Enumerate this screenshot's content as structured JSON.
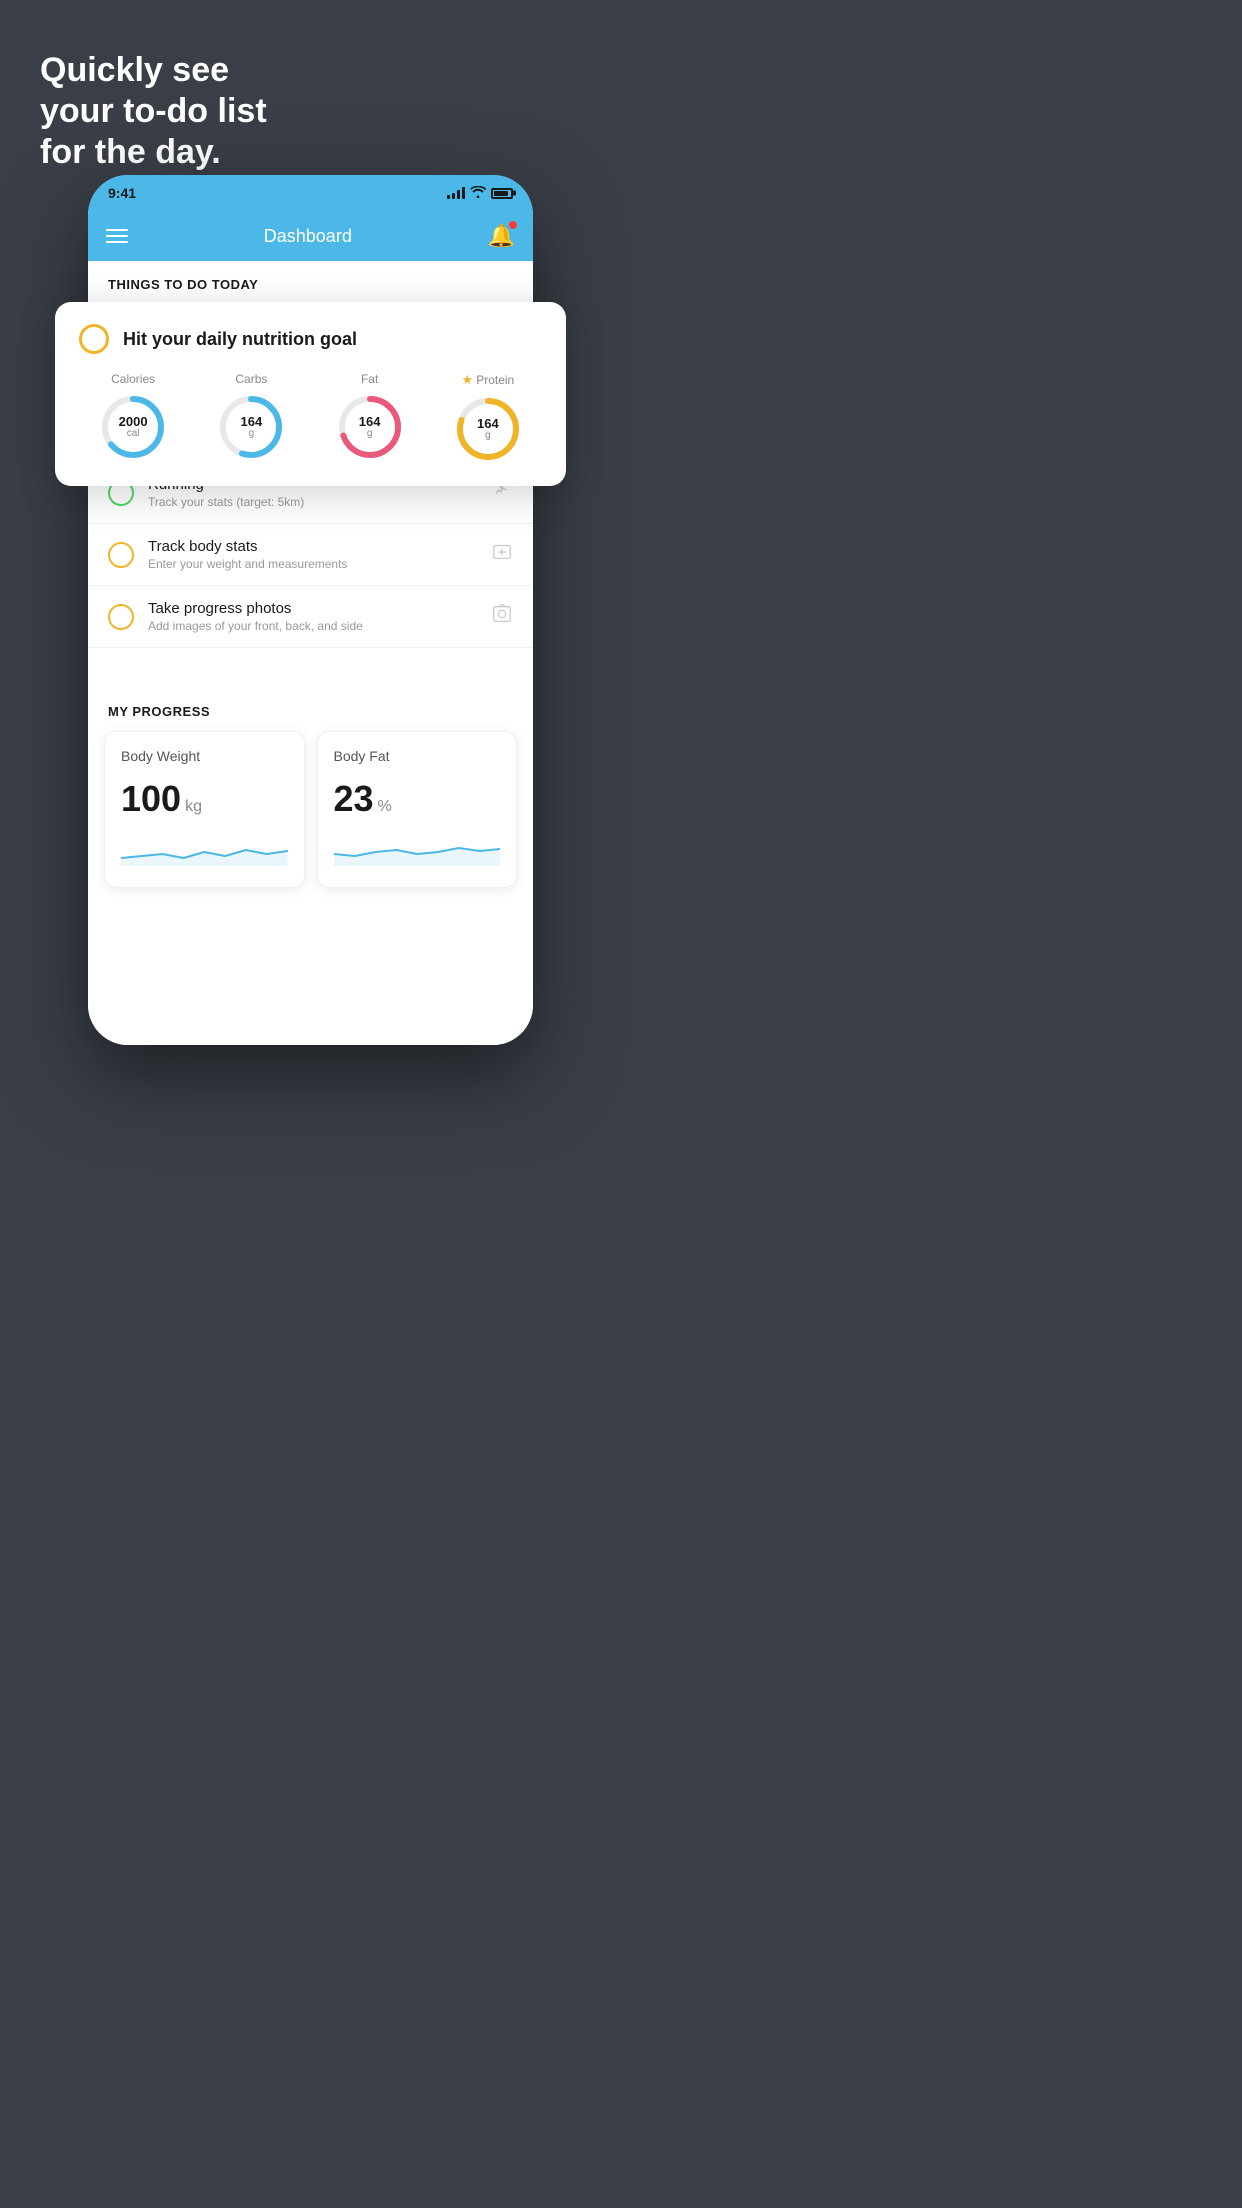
{
  "hero": {
    "line1": "Quickly see",
    "line2": "your to-do list",
    "line3": "for the day."
  },
  "statusBar": {
    "time": "9:41",
    "batteryLevel": "80"
  },
  "navBar": {
    "title": "Dashboard"
  },
  "thingsToDo": {
    "sectionTitle": "THINGS TO DO TODAY",
    "card": {
      "title": "Hit your daily nutrition goal",
      "nutrients": [
        {
          "label": "Calories",
          "value": "2000",
          "unit": "cal",
          "color": "#4cb8e8",
          "progress": 0.65,
          "starred": false
        },
        {
          "label": "Carbs",
          "value": "164",
          "unit": "g",
          "color": "#4cb8e8",
          "progress": 0.55,
          "starred": false
        },
        {
          "label": "Fat",
          "value": "164",
          "unit": "g",
          "color": "#e8597a",
          "progress": 0.7,
          "starred": false
        },
        {
          "label": "Protein",
          "value": "164",
          "unit": "g",
          "color": "#f0b429",
          "progress": 0.8,
          "starred": true
        }
      ]
    },
    "items": [
      {
        "name": "Running",
        "sub": "Track your stats (target: 5km)",
        "circleColor": "green",
        "icon": "👟"
      },
      {
        "name": "Track body stats",
        "sub": "Enter your weight and measurements",
        "circleColor": "yellow",
        "icon": "⊡"
      },
      {
        "name": "Take progress photos",
        "sub": "Add images of your front, back, and side",
        "circleColor": "yellow",
        "icon": "👤"
      }
    ]
  },
  "myProgress": {
    "sectionTitle": "MY PROGRESS",
    "cards": [
      {
        "title": "Body Weight",
        "value": "100",
        "unit": "kg"
      },
      {
        "title": "Body Fat",
        "value": "23",
        "unit": "%"
      }
    ]
  }
}
